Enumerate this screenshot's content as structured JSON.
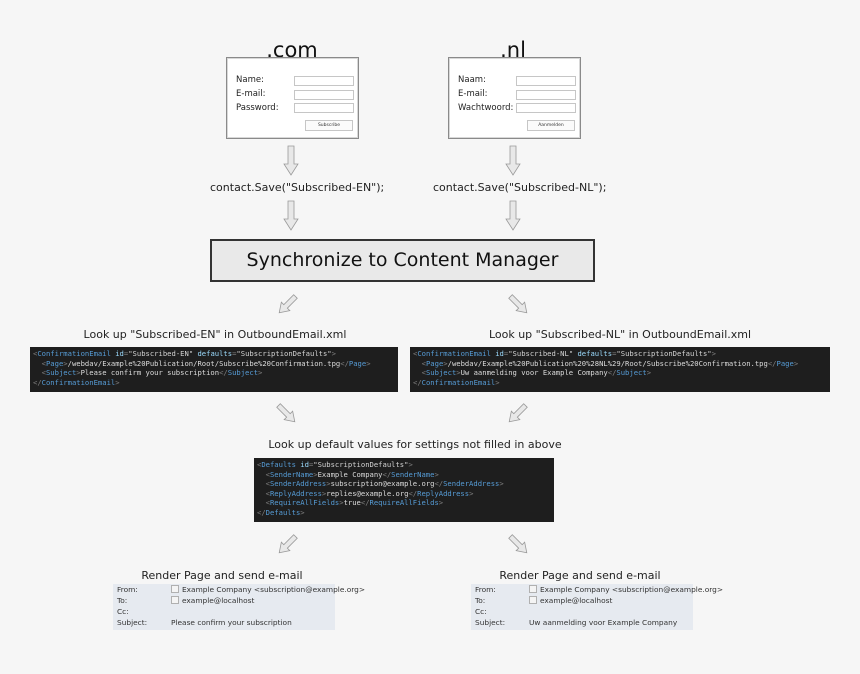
{
  "sites": {
    "com": {
      "title": ".com",
      "fields": [
        {
          "label": "Name:",
          "value": ""
        },
        {
          "label": "E-mail:",
          "value": ""
        },
        {
          "label": "Password:",
          "value": ""
        }
      ],
      "button": "Subscribe",
      "code": "contact.Save(\"Subscribed-EN\");"
    },
    "nl": {
      "title": ".nl",
      "fields": [
        {
          "label": "Naam:",
          "value": ""
        },
        {
          "label": "E-mail:",
          "value": ""
        },
        {
          "label": "Wachtwoord:",
          "value": ""
        }
      ],
      "button": "Aanmelden",
      "code": "contact.Save(\"Subscribed-NL\");"
    }
  },
  "sync": {
    "label": "Synchronize to Content Manager"
  },
  "lookups": {
    "en": {
      "caption": "Look up \"Subscribed-EN\" in OutboundEmail.xml",
      "id": "Subscribed-EN",
      "defaults": "SubscriptionDefaults",
      "page": "/webdav/Example%20Publication/Root/Subscribe%20Confirmation.tpg",
      "subject": "Please confirm your subscription"
    },
    "nl": {
      "caption": "Look up \"Subscribed-NL\" in OutboundEmail.xml",
      "id": "Subscribed-NL",
      "defaults": "SubscriptionDefaults",
      "page": "/webdav/Example%20Publication%20%28NL%29/Root/Subscribe%20Confirmation.tpg",
      "subject": "Uw aanmelding voor Example Company"
    }
  },
  "defaults": {
    "caption": "Look up default values for settings not filled in above",
    "id": "SubscriptionDefaults",
    "sender_name": "Example Company",
    "sender_address": "subscription@example.org",
    "reply_address": "replies@example.org",
    "require_all_fields": "true"
  },
  "emails": {
    "en": {
      "caption": "Render Page and send e-mail",
      "from_label": "From:",
      "from": "Example Company <subscription@example.org>",
      "to_label": "To:",
      "to": "example@localhost",
      "cc_label": "Cc:",
      "cc": "",
      "subject_label": "Subject:",
      "subject": "Please confirm your subscription"
    },
    "nl": {
      "caption": "Render Page and send e-mail",
      "from_label": "From:",
      "from": "Example Company <subscription@example.org>",
      "to_label": "To:",
      "to": "example@localhost",
      "cc_label": "Cc:",
      "cc": "",
      "subject_label": "Subject:",
      "subject": "Uw aanmelding voor Example Company"
    }
  },
  "xml_tags": {
    "confirmation": "ConfirmationEmail",
    "page": "Page",
    "subject": "Subject",
    "defaults": "Defaults",
    "sender_name": "SenderName",
    "sender_address": "SenderAddress",
    "reply_address": "ReplyAddress",
    "require_all_fields": "RequireAllFields",
    "attr_id": "id",
    "attr_defaults": "defaults"
  },
  "colors": {
    "background": "#f6f6f6",
    "code_bg": "#1e1e1e",
    "tag": "#569cd6",
    "email_bg": "#e6eaf0",
    "sync_bg": "#e9e9e9"
  }
}
